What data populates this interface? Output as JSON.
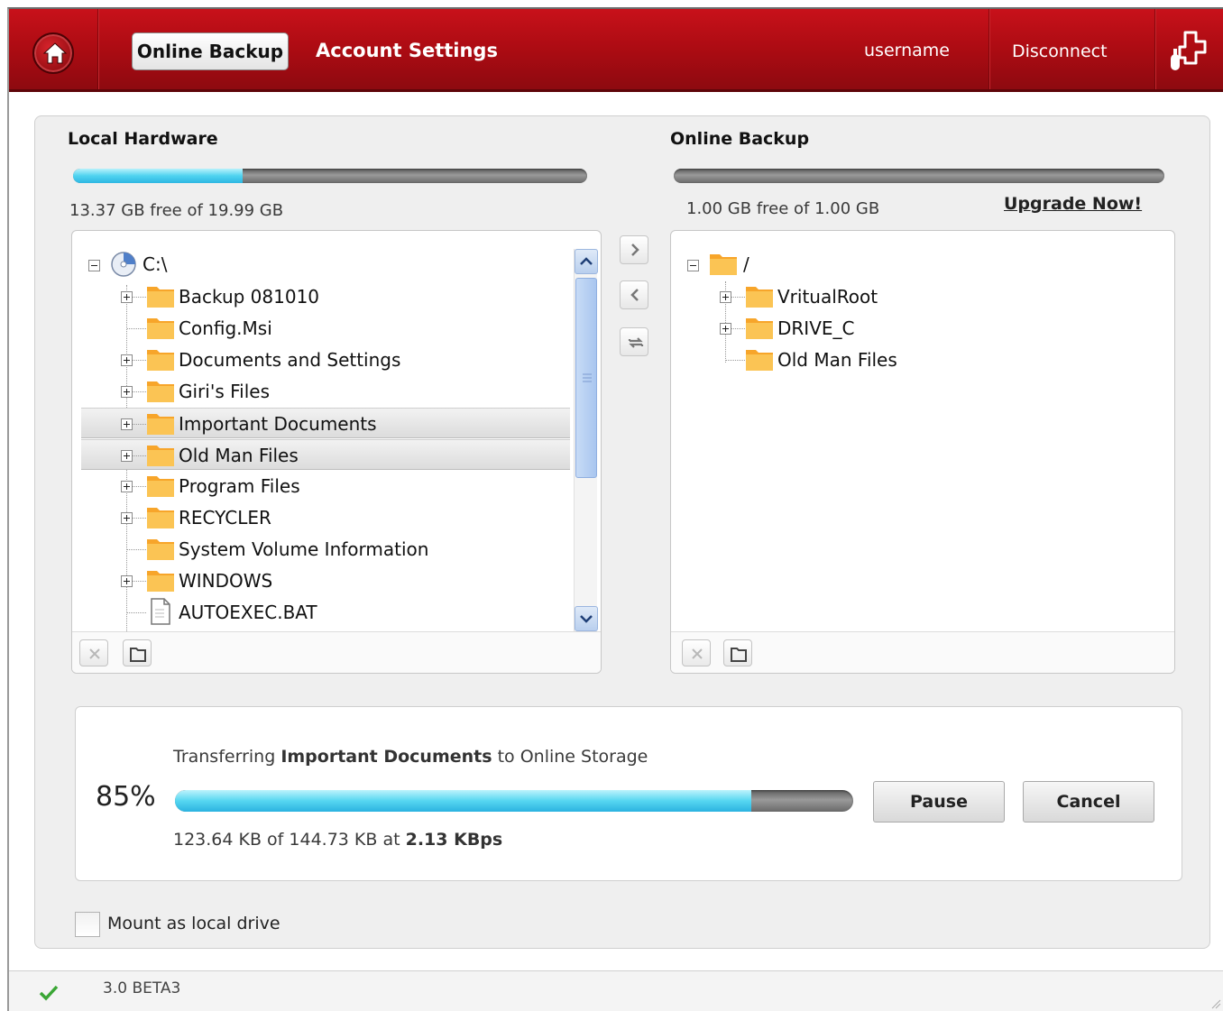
{
  "header": {
    "tabs": [
      {
        "label": "Online Backup",
        "active": true
      },
      {
        "label": "Account Settings",
        "active": false
      }
    ],
    "username": "username",
    "disconnect_label": "Disconnect"
  },
  "local": {
    "title": "Local Hardware",
    "usage_fraction": 0.33,
    "free_text": "13.37 GB free of 19.99 GB",
    "tree": {
      "root": "C:\\",
      "items": [
        {
          "label": "Backup 081010",
          "type": "folder",
          "expandable": true,
          "selected": false
        },
        {
          "label": "Config.Msi",
          "type": "folder",
          "expandable": false,
          "selected": false
        },
        {
          "label": "Documents and Settings",
          "type": "folder",
          "expandable": true,
          "selected": false
        },
        {
          "label": "Giri's Files",
          "type": "folder",
          "expandable": true,
          "selected": false
        },
        {
          "label": "Important Documents",
          "type": "folder",
          "expandable": true,
          "selected": true
        },
        {
          "label": "Old Man Files",
          "type": "folder",
          "expandable": true,
          "selected": true
        },
        {
          "label": "Program Files",
          "type": "folder",
          "expandable": true,
          "selected": false
        },
        {
          "label": "RECYCLER",
          "type": "folder",
          "expandable": true,
          "selected": false
        },
        {
          "label": "System Volume Information",
          "type": "folder",
          "expandable": false,
          "selected": false
        },
        {
          "label": "WINDOWS",
          "type": "folder",
          "expandable": true,
          "selected": false
        },
        {
          "label": "AUTOEXEC.BAT",
          "type": "file",
          "expandable": false,
          "selected": false
        }
      ]
    }
  },
  "online": {
    "title": "Online Backup",
    "usage_fraction": 0,
    "free_text": "1.00 GB free of 1.00 GB",
    "upgrade_label": "Upgrade Now!",
    "tree": {
      "root": "/",
      "items": [
        {
          "label": "VritualRoot",
          "type": "folder",
          "expandable": true
        },
        {
          "label": "DRIVE_C",
          "type": "folder",
          "expandable": true
        },
        {
          "label": "Old Man Files",
          "type": "folder",
          "expandable": false
        }
      ]
    }
  },
  "transfer": {
    "percent_label": "85%",
    "progress": 0.85,
    "prefix": "Transferring",
    "item": "Important Documents",
    "suffix": "to Online Storage",
    "amount_text": "123.64 KB of 144.73 KB at",
    "rate": "2.13 KBps",
    "pause_label": "Pause",
    "cancel_label": "Cancel"
  },
  "mount": {
    "label": "Mount as local drive",
    "checked": false
  },
  "status": {
    "version": "3.0 BETA3"
  },
  "colors": {
    "header_red": "#b20d14",
    "progress_blue": "#4fd3f0",
    "check_green": "#3aa635"
  }
}
